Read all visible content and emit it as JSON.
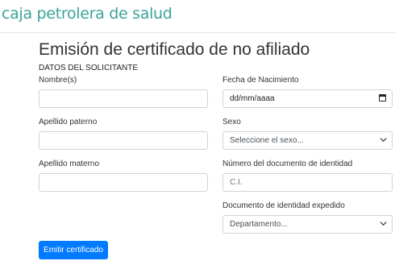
{
  "header": {
    "logo_text": "caja petrolera de salud"
  },
  "page": {
    "title": "Emisión de certificado de no afiliado",
    "section_label": "DATOS DEL SOLICITANTE"
  },
  "form": {
    "nombres": {
      "label": "Nombre(s)",
      "value": ""
    },
    "apellido_paterno": {
      "label": "Apellido paterno",
      "value": ""
    },
    "apellido_materno": {
      "label": "Apellido materno",
      "value": ""
    },
    "fecha_nacimiento": {
      "label": "Fecha de Nacimiento",
      "placeholder": "dd/mm/aaaa"
    },
    "sexo": {
      "label": "Sexo",
      "selected": "Seleccione el sexo..."
    },
    "numero_documento": {
      "label": "Número del documento de identidad",
      "placeholder": "C.I."
    },
    "documento_expedido": {
      "label": "Documento de identidad expedido",
      "selected": "Departamento..."
    }
  },
  "actions": {
    "submit_label": "Emitir certificado"
  },
  "colors": {
    "brand": "#3aa39a",
    "primary": "#007bff",
    "border": "#ced4da"
  },
  "icons": {
    "date": "calendar-icon",
    "select": "chevron-down-icon"
  }
}
